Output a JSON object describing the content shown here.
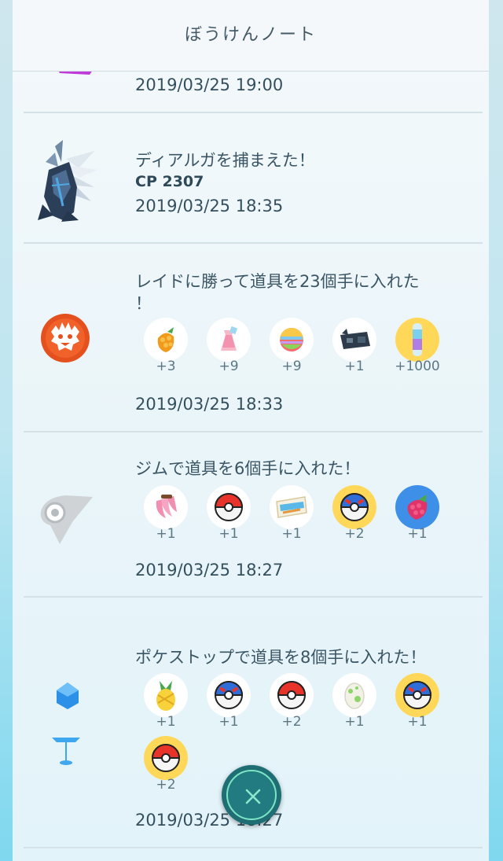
{
  "header": {
    "title": "ぼうけんノート"
  },
  "entries": [
    {
      "date": "2019/03/25 19:00"
    },
    {
      "title": "ディアルガを捕まえた！",
      "cp": "CP 2307",
      "date": "2019/03/25 18:35",
      "icon": "dialga-icon"
    },
    {
      "title_line1": "レイドに勝って道具を23個手に入れた",
      "title_line2": "！",
      "date": "2019/03/25 18:33",
      "icon": "raid-boss-icon",
      "items": [
        {
          "icon": "golden-razz-berry-icon",
          "count": "+3"
        },
        {
          "icon": "rare-candy-icon",
          "count": "+9"
        },
        {
          "icon": "rare-candy-rainbow-icon",
          "count": "+9"
        },
        {
          "icon": "fast-tm-icon",
          "count": "+1"
        },
        {
          "icon": "stardust-icon",
          "count": "+1000"
        }
      ]
    },
    {
      "title": "ジムで道具を6個手に入れた！",
      "date": "2019/03/25 18:27",
      "icon": "gym-icon",
      "items": [
        {
          "icon": "nanab-berry-icon",
          "count": "+1"
        },
        {
          "icon": "poke-ball-icon",
          "count": "+1"
        },
        {
          "icon": "raid-pass-icon",
          "count": "+1"
        },
        {
          "icon": "great-ball-icon",
          "count": "+2"
        },
        {
          "icon": "razz-berry-icon",
          "count": "+1"
        }
      ]
    },
    {
      "title": "ポケストップで道具を8個手に入れた！",
      "date": "2019/03/25 18:27",
      "icon": "pokestop-icon",
      "items": [
        {
          "icon": "pinap-berry-icon",
          "count": "+1"
        },
        {
          "icon": "great-ball-icon",
          "count": "+1"
        },
        {
          "icon": "poke-ball-icon",
          "count": "+2"
        },
        {
          "icon": "egg-icon",
          "count": "+1"
        },
        {
          "icon": "great-ball-icon",
          "count": "+1"
        },
        {
          "icon": "poke-ball-icon",
          "count": "+2"
        }
      ]
    }
  ],
  "close_button": {
    "icon": "close-icon"
  },
  "colors": {
    "accent": "#7de4c4",
    "button": "#1e6e74",
    "text": "#3a5563"
  }
}
